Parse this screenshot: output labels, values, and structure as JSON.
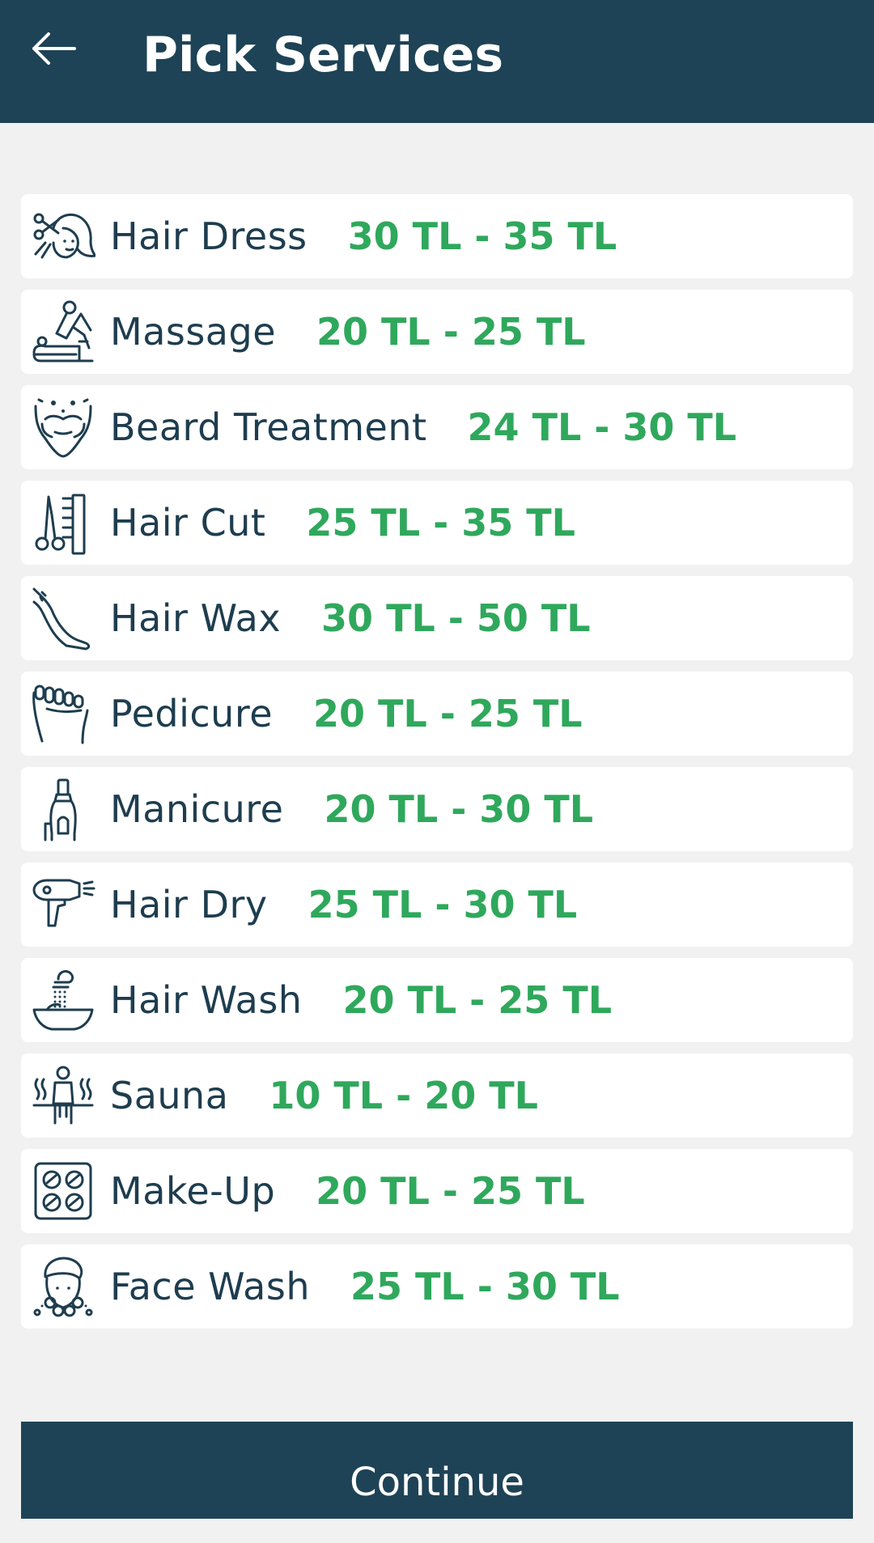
{
  "header": {
    "title": "Pick Services",
    "back_icon": "arrow-left-icon"
  },
  "colors": {
    "header_bg": "#1e4356",
    "price": "#2fa85c",
    "text": "#1e3d4f",
    "page_bg": "#f1f1f1"
  },
  "services": [
    {
      "name": "Hair Dress",
      "price": "30 TL - 35 TL",
      "icon": "hair-dress-icon"
    },
    {
      "name": "Massage",
      "price": "20 TL - 25 TL",
      "icon": "massage-icon"
    },
    {
      "name": "Beard Treatment",
      "price": "24 TL - 30 TL",
      "icon": "beard-icon"
    },
    {
      "name": "Hair Cut",
      "price": "25 TL - 35 TL",
      "icon": "scissors-comb-icon"
    },
    {
      "name": "Hair Wax",
      "price": "30 TL - 50 TL",
      "icon": "leg-wax-icon"
    },
    {
      "name": "Pedicure",
      "price": "20 TL - 25 TL",
      "icon": "foot-icon"
    },
    {
      "name": "Manicure",
      "price": "20 TL - 30 TL",
      "icon": "nail-polish-icon"
    },
    {
      "name": "Hair Dry",
      "price": "25 TL - 30 TL",
      "icon": "hair-dryer-icon"
    },
    {
      "name": "Hair Wash",
      "price": "20 TL - 25 TL",
      "icon": "hair-wash-icon"
    },
    {
      "name": "Sauna",
      "price": "10 TL - 20 TL",
      "icon": "sauna-icon"
    },
    {
      "name": "Make-Up",
      "price": "20 TL - 25 TL",
      "icon": "makeup-palette-icon"
    },
    {
      "name": "Face Wash",
      "price": "25 TL - 30 TL",
      "icon": "face-wash-icon"
    }
  ],
  "footer": {
    "continue_label": "Continue"
  }
}
